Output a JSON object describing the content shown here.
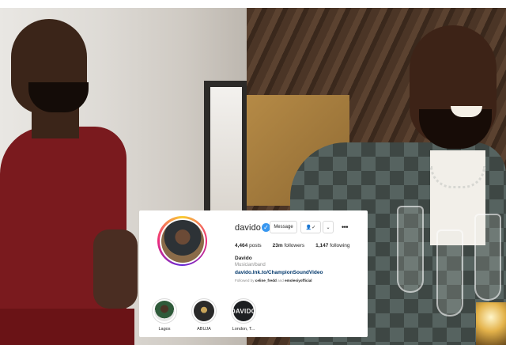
{
  "profile": {
    "username": "davido",
    "verified_icon": "✓",
    "buttons": {
      "message": "Message",
      "follow_icon": "👤✓",
      "chevron_icon": "⌄",
      "more_icon": "•••"
    },
    "stats": {
      "posts_count": "4,464",
      "posts_label": "posts",
      "followers_count": "23m",
      "followers_label": "followers",
      "following_count": "1,147",
      "following_label": "following"
    },
    "name": "Davido",
    "category": "Musician/band",
    "link": "davido.lnk.to/ChampionSoundVideo",
    "followed_by_prefix": "Followed by",
    "followed_by_1": "celine_fredd",
    "followed_by_and": "and",
    "followed_by_2": "emolesiyofficial"
  },
  "highlights": [
    {
      "label": "Lagos"
    },
    {
      "label": "ABUJA"
    },
    {
      "label": "London, T...",
      "cover_text": "DAVIDO"
    }
  ],
  "colors": {
    "verified": "#3897f0",
    "link": "#00376b",
    "muted": "#8e8e8e",
    "text": "#262626"
  }
}
